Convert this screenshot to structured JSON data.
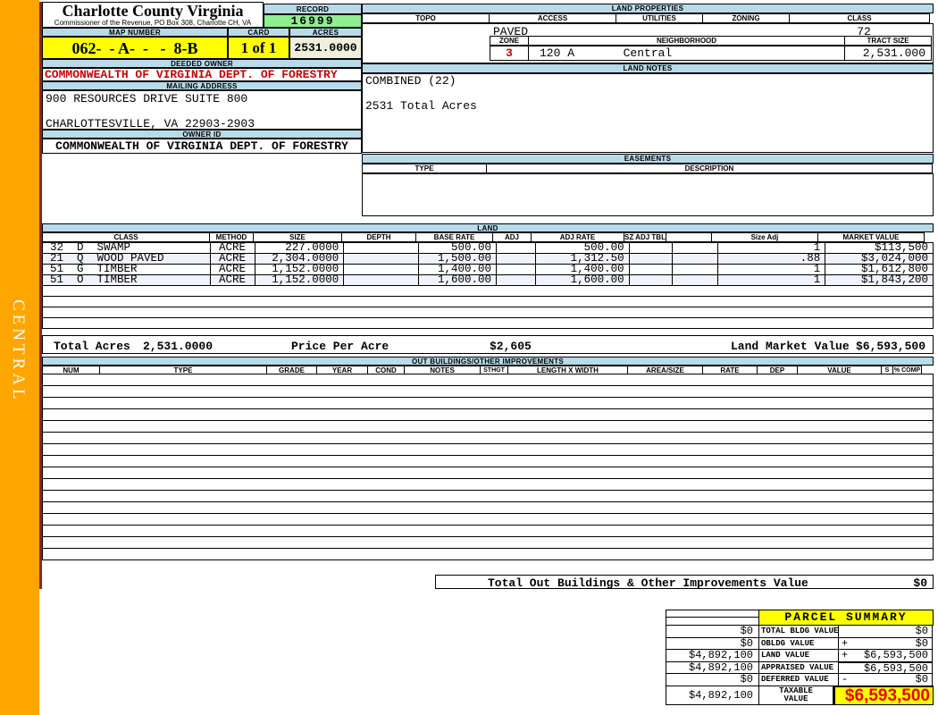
{
  "sidebar": {
    "district": "CENTRAL"
  },
  "header": {
    "title": "Charlotte County Virginia",
    "subtitle": "Commissioner of the Revenue, PO Box 308, Charlotte CH, VA",
    "record_label": "RECORD",
    "record_value": "16999",
    "map_label": "MAP NUMBER",
    "map_value": "062-  - A-  -   -  8-B",
    "card_label": "CARD",
    "card_value": "1 of 1",
    "acres_label": "ACRES",
    "acres_value": "2531.0000",
    "deeded_owner_label": "DEEDED OWNER",
    "deeded_owner": "COMMONWEALTH OF VIRGINIA DEPT. OF FORESTRY",
    "mailing_label": "MAILING ADDRESS",
    "address_line1": "900 RESOURCES DRIVE SUITE 800",
    "address_line2": "CHARLOTTESVILLE, VA 22903-2903",
    "owner_id_label": "OWNER ID",
    "owner_id": "COMMONWEALTH OF VIRGINIA DEPT. OF FORESTRY"
  },
  "land_properties": {
    "title": "LAND PROPERTIES",
    "headers": [
      "TOPO",
      "ACCESS",
      "UTILITIES",
      "ZONING",
      "CLASS"
    ],
    "topo": "",
    "access": "PAVED",
    "utilities": "",
    "zoning": "",
    "class": "72",
    "zone_label": "ZONE",
    "zone": "3",
    "neighborhood_label": "NEIGHBORHOOD",
    "neighborhood_code": "120 A",
    "neighborhood_name": "Central",
    "tract_label": "TRACT SIZE",
    "tract_size": "2,531.000"
  },
  "land_notes": {
    "title": "LAND NOTES",
    "line1": "COMBINED (22)",
    "line2": "2531 Total Acres"
  },
  "easements": {
    "title": "EASEMENTS",
    "type_label": "TYPE",
    "description_label": "DESCRIPTION"
  },
  "land": {
    "title": "LAND",
    "headers": [
      "CLASS",
      "METHOD",
      "SIZE",
      "DEPTH",
      "BASE RATE",
      "ADJ",
      "ADJ RATE",
      "SZ ADJ TBL",
      "",
      "Size Adj",
      "MARKET VALUE"
    ],
    "rows": [
      [
        "32  D  SWAMP",
        "ACRE",
        "227.0000",
        "",
        "500.00",
        "",
        "500.00",
        "",
        "",
        "1",
        "$113,500"
      ],
      [
        "21  Q  WOOD PAVED",
        "ACRE",
        "2,304.0000",
        "",
        "1,500.00",
        "",
        "1,312.50",
        "",
        "",
        ".88",
        "$3,024,000"
      ],
      [
        "51  G  TIMBER",
        "ACRE",
        "1,152.0000",
        "",
        "1,400.00",
        "",
        "1,400.00",
        "",
        "",
        "1",
        "$1,612,800"
      ],
      [
        "51  O  TIMBER",
        "ACRE",
        "1,152.0000",
        "",
        "1,600.00",
        "",
        "1,600.00",
        "",
        "",
        "1",
        "$1,843,200"
      ]
    ],
    "total_acres_label": "Total Acres",
    "total_acres": "2,531.0000",
    "price_per_acre_label": "Price Per Acre",
    "price_per_acre": "$2,605",
    "market_value_label": "Land Market Value",
    "market_value": "$6,593,500"
  },
  "out_buildings": {
    "title": "OUT BUILDINGS/OTHER IMPROVEMENTS",
    "headers": [
      "NUM",
      "TYPE",
      "GRADE",
      "YEAR",
      "COND",
      "NOTES",
      "STHGT",
      "LENGTH X WIDTH",
      "AREA/SIZE",
      "RATE",
      "DEP",
      "VALUE",
      "S",
      "% COMP"
    ],
    "total_label": "Total Out Buildings & Other Improvements Value",
    "total_value": "$0"
  },
  "parcel_summary": {
    "title": "PARCEL SUMMARY",
    "rows": [
      {
        "prev": "$0",
        "label": "TOTAL BLDG VALUE",
        "sym": "",
        "value": "$0"
      },
      {
        "prev": "$0",
        "label": "OBLDG VALUE",
        "sym": "+",
        "value": "$0"
      },
      {
        "prev": "$4,892,100",
        "label": "LAND VALUE",
        "sym": "+",
        "value": "$6,593,500"
      },
      {
        "prev": "$4,892,100",
        "label": "APPRAISED VALUE",
        "sym": "",
        "value": "$6,593,500"
      },
      {
        "prev": "$0",
        "label": "DEFERRED VALUE",
        "sym": "-",
        "value": "$0"
      }
    ],
    "taxable": {
      "prev": "$4,892,100",
      "label_line1": "TAXABLE",
      "label_line2": "VALUE",
      "value": "$6,593,500"
    }
  },
  "colors": {
    "accent_orange": "#FFA500",
    "header_blue": "#B9DAE9",
    "record_green": "#90EE90",
    "highlight_yellow": "#FFFF00",
    "alert_red": "#CC0000"
  }
}
